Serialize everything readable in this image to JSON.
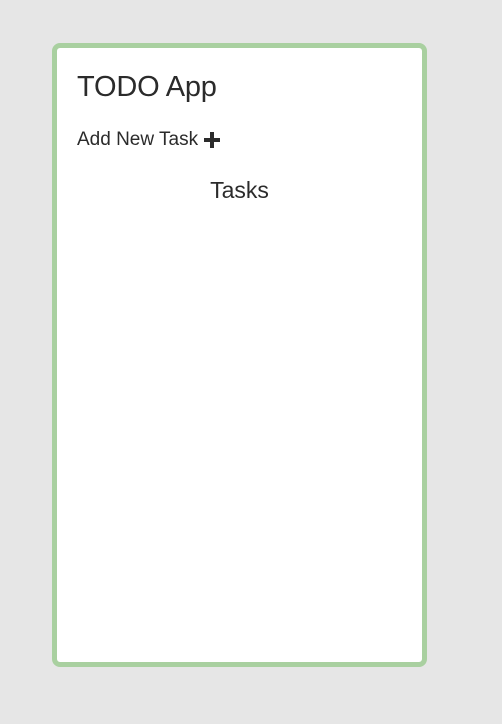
{
  "app": {
    "title": "TODO App"
  },
  "add_task": {
    "label": "Add New Task",
    "icon": "plus-icon"
  },
  "tasks": {
    "heading": "Tasks",
    "items": []
  },
  "colors": {
    "background": "#e6e6e6",
    "card_border": "#a9d0a0",
    "card_background": "#ffffff",
    "text": "#2b2b2b"
  }
}
